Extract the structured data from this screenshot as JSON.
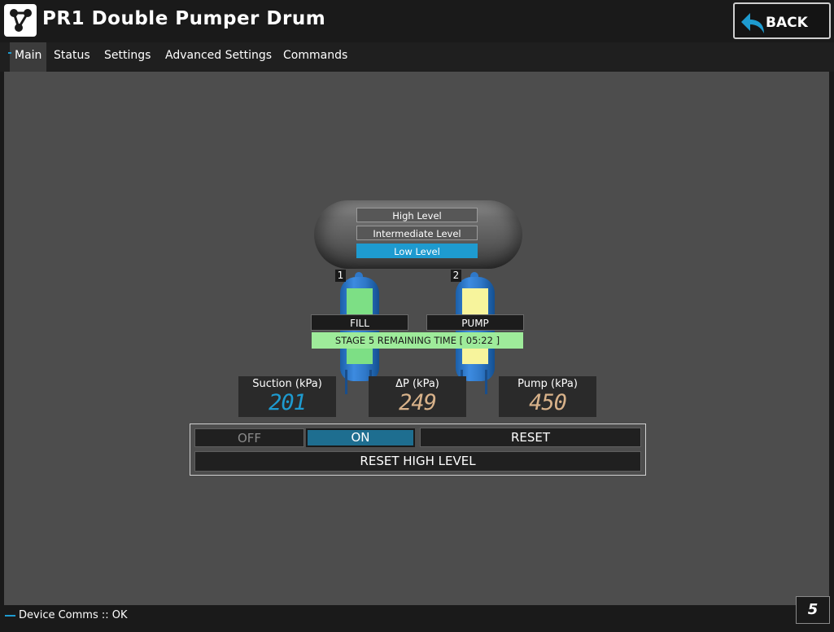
{
  "app": {
    "title": "PR1 Double Pumper Drum",
    "back_label": "BACK"
  },
  "tabs": [
    {
      "label": "Main",
      "active": true
    },
    {
      "label": "Status"
    },
    {
      "label": "Settings"
    },
    {
      "label": "Advanced Settings"
    },
    {
      "label": "Commands"
    }
  ],
  "drum": {
    "levels": [
      {
        "label": "High Level",
        "active": false
      },
      {
        "label": "Intermediate Level",
        "active": false
      },
      {
        "label": "Low Level",
        "active": true
      }
    ]
  },
  "pumpers": [
    {
      "number": "1",
      "state": "FILL",
      "fill_color": "#7ddf85"
    },
    {
      "number": "2",
      "state": "PUMP",
      "fill_color": "#f7f49c"
    }
  ],
  "stage": {
    "text": "STAGE 5 REMAINING TIME [ 05:22 ]"
  },
  "gauges": [
    {
      "label": "Suction (kPa)",
      "value": "201",
      "color": "#1e9bd0"
    },
    {
      "label": "ΔP (kPa)",
      "value": "249",
      "color": "#d8b28a"
    },
    {
      "label": "Pump (kPa)",
      "value": "450",
      "color": "#d8b28a"
    }
  ],
  "controls": {
    "off_label": "OFF",
    "on_label": "ON",
    "reset_label": "RESET",
    "reset_high_label": "RESET HIGH LEVEL"
  },
  "status": {
    "comms": "Device Comms :: OK",
    "page": "5"
  },
  "colors": {
    "accent": "#1e9bd0",
    "panel": "#4d4d4d",
    "stage_ok": "#9eeb9a"
  }
}
